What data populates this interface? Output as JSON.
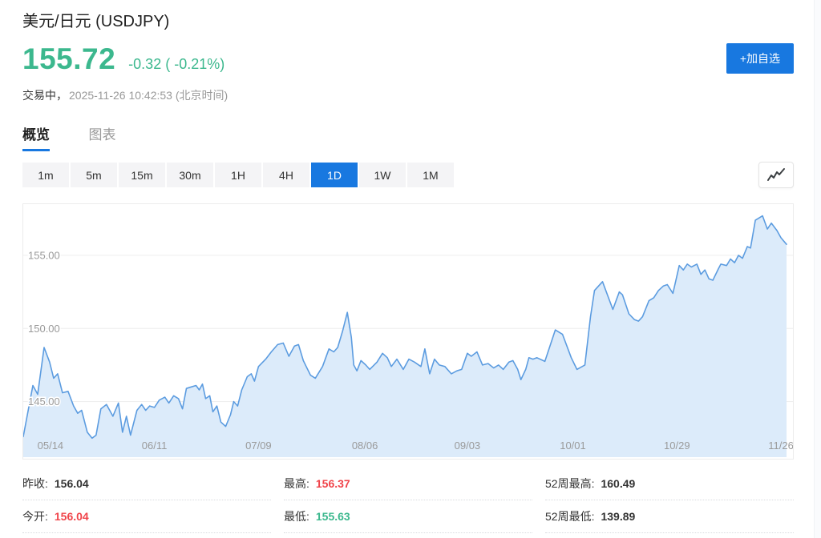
{
  "header": {
    "title": "美元/日元 (USDJPY)",
    "price": "155.72",
    "change": "-0.32 ( -0.21%)",
    "status_label": "交易中，",
    "timestamp": "2025-11-26 10:42:53 (北京时间)",
    "add_watchlist_label": "+加自选"
  },
  "tabs": [
    {
      "label": "概览",
      "active": true
    },
    {
      "label": "图表",
      "active": false
    }
  ],
  "timeframes": {
    "items": [
      "1m",
      "5m",
      "15m",
      "30m",
      "1H",
      "4H",
      "1D",
      "1W",
      "1M"
    ],
    "active": "1D"
  },
  "colors": {
    "blue": "#1878e0",
    "green": "#3cb88e",
    "red": "#f0444a"
  },
  "chart_data": {
    "type": "area",
    "title": "USDJPY daily price history 05/14 - 11/26",
    "ylim": [
      141.2,
      158.5
    ],
    "grid": true,
    "line_color": "#5c9ce0",
    "fill_color": "#dcebfa",
    "y_ticks": [
      {
        "label": "155.00",
        "v": 155
      },
      {
        "label": "150.00",
        "v": 150
      },
      {
        "label": "145.00",
        "v": 145
      }
    ],
    "x_ticks": [
      {
        "label": "05/14",
        "t": 0.0356
      },
      {
        "label": "06/11",
        "t": 0.1719
      },
      {
        "label": "07/09",
        "t": 0.3082
      },
      {
        "label": "08/06",
        "t": 0.4476
      },
      {
        "label": "09/03",
        "t": 0.5818
      },
      {
        "label": "10/01",
        "t": 0.7201
      },
      {
        "label": "10/29",
        "t": 0.8564
      },
      {
        "label": "11/26",
        "t": 0.9927
      }
    ],
    "points": [
      [
        0.0,
        142.6
      ],
      [
        0.0126,
        146.1
      ],
      [
        0.0189,
        145.5
      ],
      [
        0.0273,
        148.7
      ],
      [
        0.0346,
        147.7
      ],
      [
        0.0398,
        146.6
      ],
      [
        0.0451,
        146.9
      ],
      [
        0.0514,
        145.6
      ],
      [
        0.0587,
        145.7
      ],
      [
        0.066,
        144.7
      ],
      [
        0.0713,
        144.2
      ],
      [
        0.0765,
        144.4
      ],
      [
        0.0839,
        142.9
      ],
      [
        0.0901,
        142.5
      ],
      [
        0.0954,
        142.7
      ],
      [
        0.1017,
        144.5
      ],
      [
        0.109,
        144.8
      ],
      [
        0.1174,
        144.0
      ],
      [
        0.1247,
        144.9
      ],
      [
        0.13,
        142.9
      ],
      [
        0.1352,
        144.0
      ],
      [
        0.1405,
        142.7
      ],
      [
        0.1489,
        144.4
      ],
      [
        0.1551,
        144.8
      ],
      [
        0.1604,
        144.4
      ],
      [
        0.1656,
        144.7
      ],
      [
        0.1719,
        144.6
      ],
      [
        0.1782,
        145.1
      ],
      [
        0.1855,
        145.3
      ],
      [
        0.1908,
        144.9
      ],
      [
        0.1971,
        145.4
      ],
      [
        0.2034,
        145.2
      ],
      [
        0.2086,
        144.5
      ],
      [
        0.2138,
        145.9
      ],
      [
        0.2201,
        146.0
      ],
      [
        0.2264,
        146.1
      ],
      [
        0.2306,
        145.8
      ],
      [
        0.2348,
        146.2
      ],
      [
        0.239,
        145.2
      ],
      [
        0.2443,
        145.4
      ],
      [
        0.2484,
        144.3
      ],
      [
        0.2537,
        144.7
      ],
      [
        0.2589,
        143.6
      ],
      [
        0.2652,
        143.3
      ],
      [
        0.2715,
        144.1
      ],
      [
        0.2757,
        145.0
      ],
      [
        0.2809,
        144.7
      ],
      [
        0.2862,
        145.8
      ],
      [
        0.2935,
        146.7
      ],
      [
        0.2987,
        146.9
      ],
      [
        0.3029,
        146.4
      ],
      [
        0.3082,
        147.4
      ],
      [
        0.3176,
        147.9
      ],
      [
        0.325,
        148.4
      ],
      [
        0.3333,
        148.9
      ],
      [
        0.3407,
        149.0
      ],
      [
        0.348,
        148.1
      ],
      [
        0.3554,
        148.8
      ],
      [
        0.3606,
        148.9
      ],
      [
        0.3669,
        147.8
      ],
      [
        0.3764,
        146.8
      ],
      [
        0.3827,
        146.6
      ],
      [
        0.3921,
        147.4
      ],
      [
        0.4005,
        148.6
      ],
      [
        0.4068,
        148.4
      ],
      [
        0.412,
        148.7
      ],
      [
        0.4183,
        149.8
      ],
      [
        0.4246,
        151.1
      ],
      [
        0.4298,
        149.4
      ],
      [
        0.433,
        147.5
      ],
      [
        0.4372,
        147.1
      ],
      [
        0.4424,
        147.8
      ],
      [
        0.4487,
        147.5
      ],
      [
        0.4539,
        147.2
      ],
      [
        0.4634,
        147.7
      ],
      [
        0.4707,
        148.3
      ],
      [
        0.477,
        148.0
      ],
      [
        0.4822,
        147.4
      ],
      [
        0.4895,
        147.9
      ],
      [
        0.4979,
        147.2
      ],
      [
        0.5052,
        147.9
      ],
      [
        0.5126,
        147.7
      ],
      [
        0.521,
        147.4
      ],
      [
        0.5262,
        148.6
      ],
      [
        0.5325,
        146.9
      ],
      [
        0.5388,
        147.9
      ],
      [
        0.5451,
        147.5
      ],
      [
        0.5524,
        147.4
      ],
      [
        0.5608,
        146.9
      ],
      [
        0.5682,
        147.1
      ],
      [
        0.5744,
        147.2
      ],
      [
        0.5818,
        148.3
      ],
      [
        0.587,
        148.1
      ],
      [
        0.5944,
        148.4
      ],
      [
        0.6017,
        147.5
      ],
      [
        0.609,
        147.6
      ],
      [
        0.6164,
        147.3
      ],
      [
        0.6227,
        147.5
      ],
      [
        0.6289,
        147.2
      ],
      [
        0.6363,
        147.7
      ],
      [
        0.6415,
        147.8
      ],
      [
        0.6478,
        147.2
      ],
      [
        0.652,
        146.5
      ],
      [
        0.6583,
        147.2
      ],
      [
        0.6625,
        148.0
      ],
      [
        0.6677,
        147.9
      ],
      [
        0.673,
        148.0
      ],
      [
        0.6834,
        147.75
      ],
      [
        0.6971,
        149.9
      ],
      [
        0.7065,
        149.6
      ],
      [
        0.718,
        148.0
      ],
      [
        0.7254,
        147.2
      ],
      [
        0.7358,
        147.5
      ],
      [
        0.7432,
        150.8
      ],
      [
        0.7484,
        152.6
      ],
      [
        0.7589,
        153.2
      ],
      [
        0.7725,
        151.3
      ],
      [
        0.7809,
        152.5
      ],
      [
        0.7851,
        152.3
      ],
      [
        0.7935,
        151.0
      ],
      [
        0.8008,
        150.6
      ],
      [
        0.8061,
        150.5
      ],
      [
        0.8113,
        150.8
      ],
      [
        0.8197,
        151.9
      ],
      [
        0.826,
        152.1
      ],
      [
        0.8323,
        152.6
      ],
      [
        0.8386,
        152.9
      ],
      [
        0.8438,
        153.0
      ],
      [
        0.8512,
        152.4
      ],
      [
        0.8595,
        154.3
      ],
      [
        0.8648,
        154.0
      ],
      [
        0.87,
        154.4
      ],
      [
        0.8753,
        154.2
      ],
      [
        0.8826,
        154.4
      ],
      [
        0.8878,
        153.7
      ],
      [
        0.8931,
        154.0
      ],
      [
        0.8983,
        153.4
      ],
      [
        0.9035,
        153.3
      ],
      [
        0.9109,
        154.1
      ],
      [
        0.914,
        154.4
      ],
      [
        0.9214,
        154.3
      ],
      [
        0.9266,
        154.75
      ],
      [
        0.9319,
        154.5
      ],
      [
        0.9371,
        155.0
      ],
      [
        0.9423,
        154.8
      ],
      [
        0.9486,
        155.6
      ],
      [
        0.9528,
        155.5
      ],
      [
        0.9591,
        157.4
      ],
      [
        0.9686,
        157.7
      ],
      [
        0.9749,
        156.8
      ],
      [
        0.9801,
        157.2
      ],
      [
        0.9874,
        156.7
      ],
      [
        0.9927,
        156.2
      ],
      [
        1.0,
        155.75
      ]
    ]
  },
  "stats": [
    {
      "label": "昨收:",
      "value": "156.04",
      "color": "#333333"
    },
    {
      "label": "今开:",
      "value": "156.04",
      "color": "#f0444a"
    },
    {
      "label": "最高:",
      "value": "156.37",
      "color": "#f0444a"
    },
    {
      "label": "最低:",
      "value": "155.63",
      "color": "#3cb88e"
    },
    {
      "label": "52周最高:",
      "value": "160.49",
      "color": "#333333"
    },
    {
      "label": "52周最低:",
      "value": "139.89",
      "color": "#333333"
    }
  ]
}
